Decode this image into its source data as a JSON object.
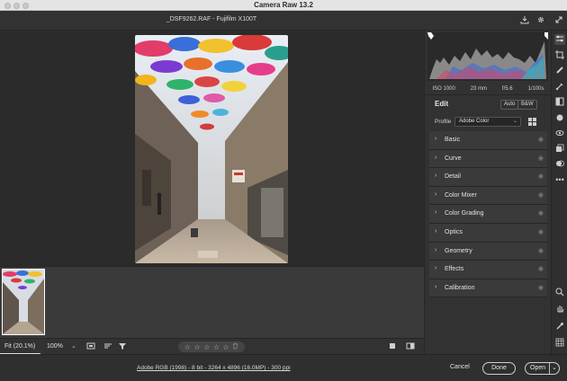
{
  "window": {
    "title": "Camera Raw 13.2"
  },
  "header": {
    "file_title": "_DSF9262.RAF  -  Fujifilm X100T"
  },
  "icons": {
    "save": "download-icon",
    "settings": "gear-icon",
    "fullscreen": "expand-icon"
  },
  "exif": {
    "iso": "ISO 1000",
    "focal": "23 mm",
    "aperture": "f/5.6",
    "shutter": "1/100s"
  },
  "edit": {
    "title": "Edit",
    "auto_label": "Auto",
    "bw_label": "B&W",
    "profile_label": "Profile",
    "profile_value": "Adobe Color"
  },
  "sections": [
    {
      "name": "Basic"
    },
    {
      "name": "Curve"
    },
    {
      "name": "Detail"
    },
    {
      "name": "Color Mixer"
    },
    {
      "name": "Color Grading"
    },
    {
      "name": "Optics"
    },
    {
      "name": "Geometry"
    },
    {
      "name": "Effects"
    },
    {
      "name": "Calibration"
    }
  ],
  "bottombar": {
    "zoom_fit": "Fit (20.1%)",
    "zoom_pct": "100%"
  },
  "footer": {
    "color_info": "Adobe RGB (1998) - 8 bit - 3264 x 4896 (16.0MP) - 300 ppi",
    "cancel_label": "Cancel",
    "done_label": "Done",
    "open_label": "Open"
  }
}
